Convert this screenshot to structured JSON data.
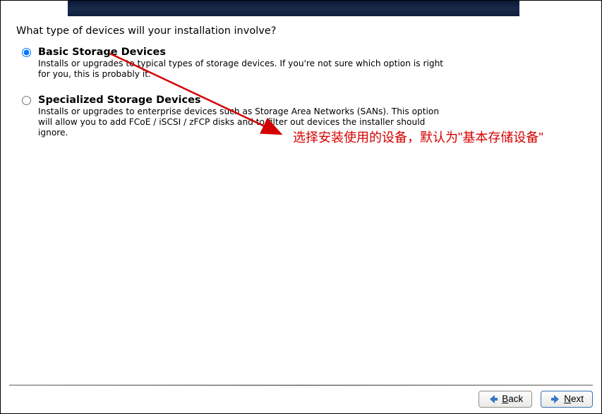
{
  "question": "What type of devices will your installation involve?",
  "options": [
    {
      "title": "Basic Storage Devices",
      "desc": "Installs or upgrades to typical types of storage devices.  If you're not sure which option is right for you, this is probably it.",
      "selected": true
    },
    {
      "title": "Specialized Storage Devices",
      "desc": "Installs or upgrades to enterprise devices such as Storage Area Networks (SANs). This option will allow you to add FCoE / iSCSI / zFCP disks and to filter out devices the installer should ignore.",
      "selected": false
    }
  ],
  "annotation": "选择安装使用的设备，默认为\"基本存储设备\"",
  "buttons": {
    "back_letter": "B",
    "back_rest": "ack",
    "next_letter": "N",
    "next_rest": "ext"
  },
  "colors": {
    "annotation": "#d40000",
    "banner": "#0a1838"
  }
}
